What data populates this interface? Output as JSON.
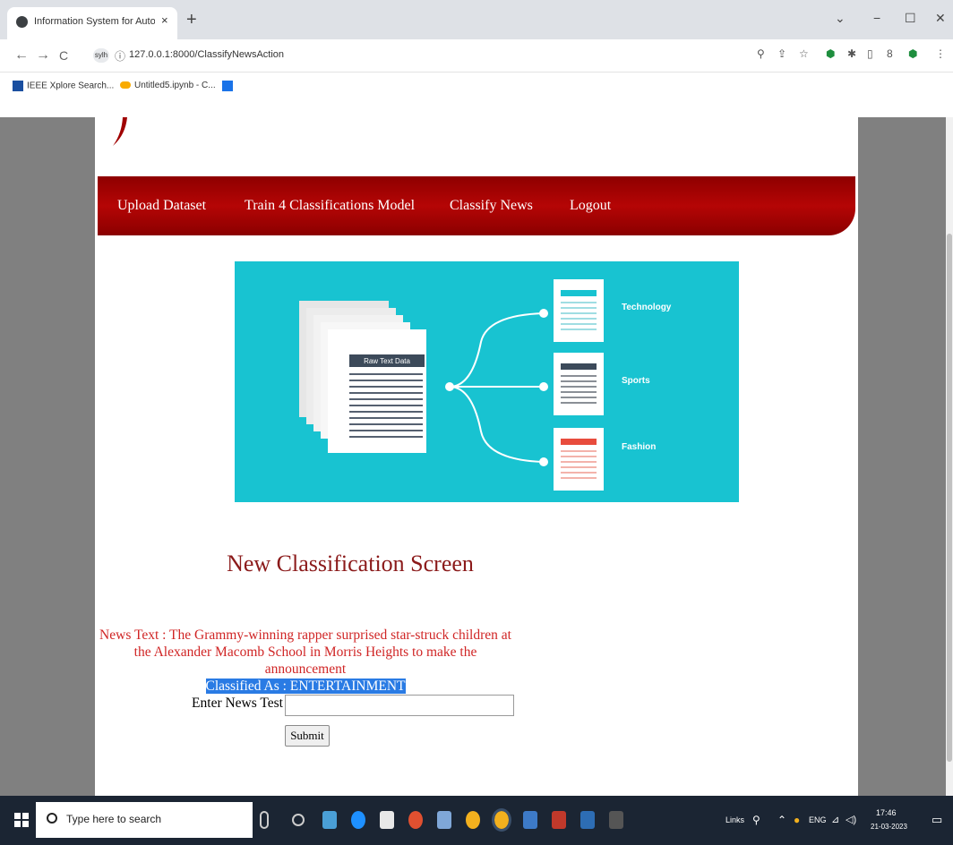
{
  "browser": {
    "tab_title": "Information System for Automa",
    "tab_close": "×",
    "new_tab": "+",
    "url_badge": "sylh",
    "url": "127.0.0.1:8000/ClassifyNewsAction",
    "window_controls": [
      "⌄",
      "−",
      "☐",
      "✕"
    ],
    "nav": [
      "←",
      "→",
      "C"
    ],
    "toolbar_icons": [
      "zoom-icon",
      "share-icon",
      "star-icon",
      "shield-extension-icon",
      "puzzle-icon",
      "sidebar-icon",
      "profile-icon",
      "shield-extension-icon",
      "menu-icon"
    ]
  },
  "bookmarks": [
    {
      "label": "IEEE Xplore Search...",
      "icon": "ieee-icon",
      "color": "#1a4fa0"
    },
    {
      "label": "Untitled5.ipynb - C...",
      "icon": "colab-icon",
      "color": "#f9ab00"
    },
    {
      "label": "",
      "icon": "blue-square-icon",
      "color": "#1a73e8"
    }
  ],
  "menu": {
    "items": [
      "Upload Dataset",
      "Train 4 Classifications Model",
      "Classify News",
      "Logout"
    ]
  },
  "banner": {
    "raw_label": "Raw Text Data",
    "categories": [
      "Technology",
      "Sports",
      "Fashion"
    ],
    "bg_color": "#18c3d1"
  },
  "main": {
    "title": "New Classification Screen",
    "news_text_line1": "News Text : The Grammy-winning rapper surprised star-struck children at",
    "news_text_line2": "the Alexander Macomb School in Morris Heights to make the announcement",
    "classified_as": "Classified As : ENTERTAINMENT",
    "input_label": "Enter News Test",
    "input_value": "",
    "submit_label": "Submit"
  },
  "taskbar": {
    "search_placeholder": "Type here to search",
    "links_label": "Links",
    "lang": "ENG",
    "time": "17:46",
    "date": "21-03-2023"
  }
}
